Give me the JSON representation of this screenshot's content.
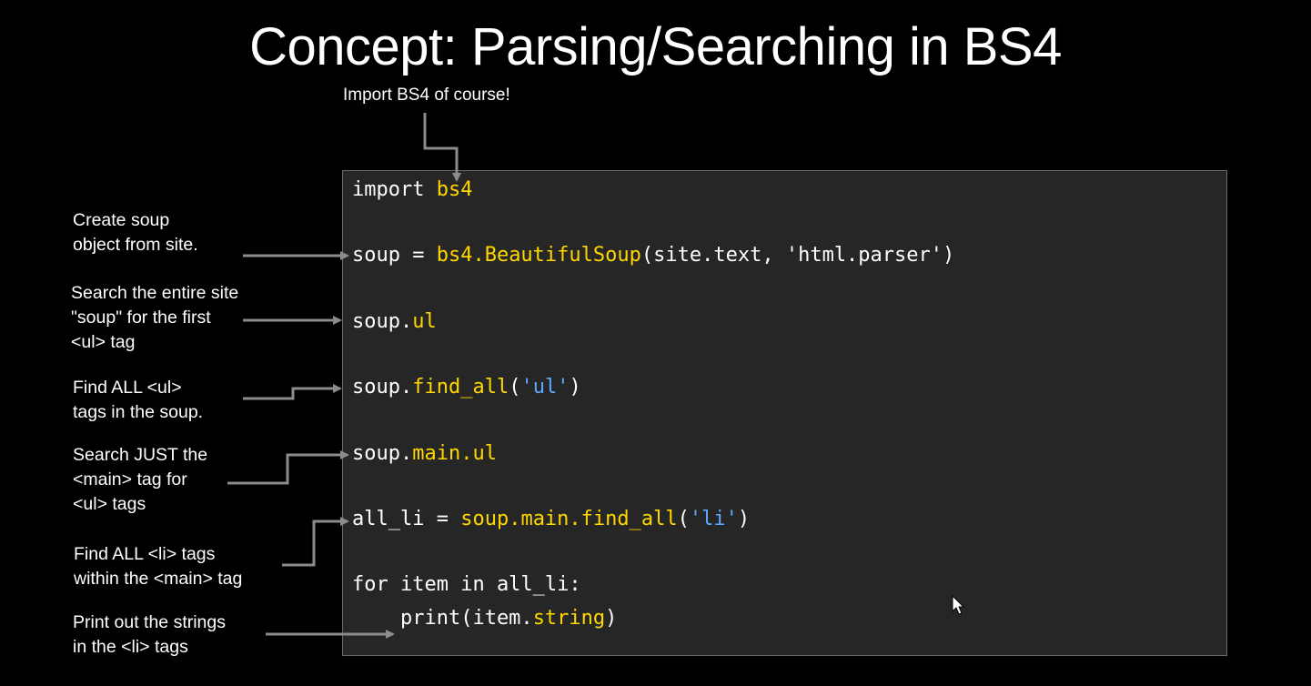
{
  "title": "Concept: Parsing/Searching in BS4",
  "import_note": "Import BS4 of course!",
  "labels": [
    [
      "Create soup",
      "object from site."
    ],
    [
      "Search the entire site",
      "\"soup\" for the first",
      "<ul> tag"
    ],
    [
      "Find ALL <ul>",
      "tags in the soup."
    ],
    [
      "Search JUST the",
      "<main> tag for",
      "<ul> tags"
    ],
    [
      "Find ALL <li> tags",
      "within the <main> tag"
    ],
    [
      "Print out the strings",
      "in the <li> tags"
    ]
  ],
  "code": {
    "l1": [
      "import ",
      "bs4"
    ],
    "l2": [
      "soup = ",
      "bs4.BeautifulSoup",
      "(site.text, 'html.parser')"
    ],
    "l3": [
      "soup.",
      "ul"
    ],
    "l4": [
      "soup.",
      "find_all",
      "(",
      "'ul'",
      ")"
    ],
    "l5": [
      "soup.",
      "main.ul"
    ],
    "l6": [
      "all_li = ",
      "soup.main.find_all",
      "(",
      "'li'",
      ")"
    ],
    "l7": [
      "for item in all_li:"
    ],
    "l8": [
      "    print(item.",
      "string",
      ")"
    ]
  },
  "colors": {
    "background": "#000000",
    "code_background": "#262626",
    "keyword_highlight": "#ffd700",
    "string_highlight": "#5fa8ff",
    "arrow": "#8c8c8c"
  }
}
